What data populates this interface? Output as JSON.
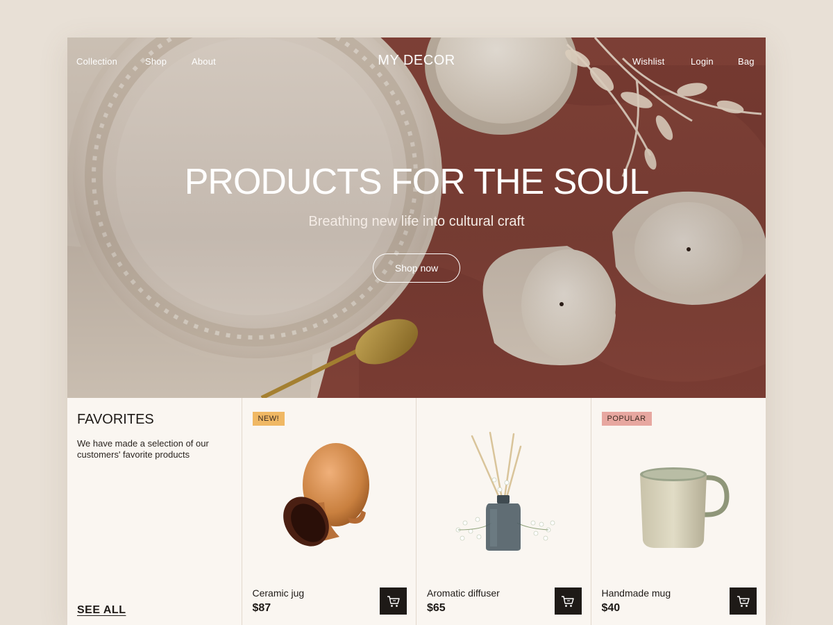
{
  "nav": {
    "left": [
      "Collection",
      "Shop",
      "About"
    ],
    "logo": "MY DECOR",
    "right": [
      "Wishlist",
      "Login",
      "Bag"
    ]
  },
  "hero": {
    "title": "PRODUCTS FOR THE SOUL",
    "subtitle": "Breathing new life into cultural craft",
    "cta": "Shop now"
  },
  "favorites": {
    "title": "FAVORITES",
    "description": "We have made a selection of our customers' favorite products",
    "see_all": "SEE ALL"
  },
  "products": [
    {
      "badge": "NEW!",
      "name": "Ceramic jug",
      "price": "$87",
      "image": "ceramic-jug"
    },
    {
      "badge": "",
      "name": "Aromatic diffuser",
      "price": "$65",
      "image": "reed-diffuser"
    },
    {
      "badge": "POPULAR",
      "name": "Handmade mug",
      "price": "$40",
      "image": "handmade-mug"
    }
  ],
  "icons": {
    "cart": "shopping-cart-icon"
  },
  "colors": {
    "background": "#e8e0d6",
    "card": "#faf6f1",
    "badge_new": "#f0b864",
    "badge_popular": "#e7a7a0",
    "cart_button": "#1e1a17",
    "hero_cloth": "#86443a"
  }
}
